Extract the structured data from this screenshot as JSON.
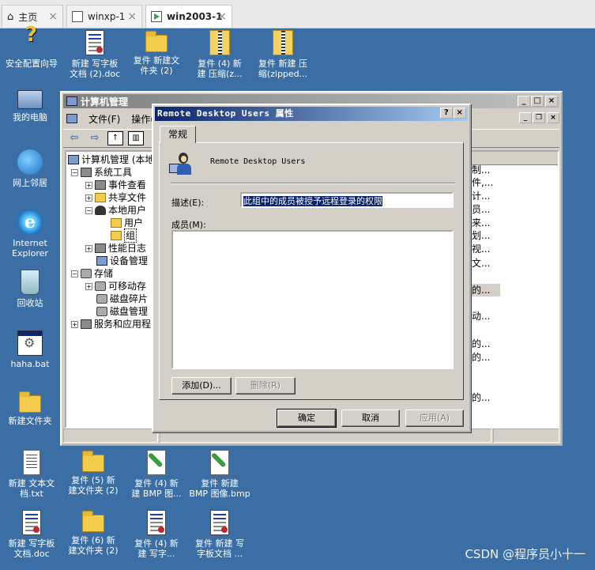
{
  "browser_tabs": [
    {
      "label": "主页",
      "icon": "home-icon"
    },
    {
      "label": "winxp-1",
      "icon": "vm-icon"
    },
    {
      "label": "win2003-1",
      "icon": "vm-icon",
      "active": true
    }
  ],
  "desktop_icons": [
    {
      "label": "安全配置向导",
      "icon": "wizard-icon"
    },
    {
      "label": "新建 写字板\n文档 (2).doc",
      "icon": "wordpad-doc-icon"
    },
    {
      "label": "复件 新建文\n件夹 (2)",
      "icon": "folder-icon"
    },
    {
      "label": "复件 (4) 新\n建 压缩(z...",
      "icon": "zip-icon"
    },
    {
      "label": "复件 新建 压\n缩(zipped...",
      "icon": "zip-icon"
    },
    {
      "label": "我的电脑",
      "icon": "my-computer-icon"
    },
    {
      "label": "网上邻居",
      "icon": "network-icon"
    },
    {
      "label": "Internet\nExplorer",
      "icon": "ie-icon"
    },
    {
      "label": "回收站",
      "icon": "recycle-bin-icon"
    },
    {
      "label": "haha.bat",
      "icon": "batch-file-icon"
    },
    {
      "label": "新建文件夹",
      "icon": "folder-icon"
    },
    {
      "label": "新建 文本文\n档.txt",
      "icon": "text-file-icon"
    },
    {
      "label": "复件 (5) 新\n建文件夹 (2)",
      "icon": "folder-icon"
    },
    {
      "label": "复件 (4) 新\n建 BMP 图...",
      "icon": "bmp-icon"
    },
    {
      "label": "复件 新建\nBMP 图像.bmp",
      "icon": "bmp-icon"
    },
    {
      "label": "新建 写字板\n文档.doc",
      "icon": "wordpad-doc-icon"
    },
    {
      "label": "复件 (6) 新\n建文件夹 (2)",
      "icon": "folder-icon"
    },
    {
      "label": "复件 (4) 新\n建 写字...",
      "icon": "wordpad-doc-icon"
    },
    {
      "label": "复件 新建 写\n字板文档 ...",
      "icon": "wordpad-doc-icon"
    }
  ],
  "cm_window": {
    "title": "计算机管理",
    "menu": [
      "文件(F)",
      "操作("
    ],
    "tree": [
      {
        "label": "计算机管理 (本地",
        "indent": 0,
        "expander": ""
      },
      {
        "label": "系统工具",
        "indent": 1,
        "expander": "−"
      },
      {
        "label": "事件查看",
        "indent": 2,
        "expander": "+"
      },
      {
        "label": "共享文件",
        "indent": 2,
        "expander": "+"
      },
      {
        "label": "本地用户",
        "indent": 2,
        "expander": "−"
      },
      {
        "label": "用户",
        "indent": 3,
        "expander": ""
      },
      {
        "label": "组",
        "indent": 3,
        "expander": ""
      },
      {
        "label": "性能日志",
        "indent": 2,
        "expander": "+"
      },
      {
        "label": "设备管理",
        "indent": 2,
        "expander": ""
      },
      {
        "label": "存储",
        "indent": 1,
        "expander": "−"
      },
      {
        "label": "可移动存",
        "indent": 2,
        "expander": "+"
      },
      {
        "label": "磁盘碎片",
        "indent": 2,
        "expander": ""
      },
      {
        "label": "磁盘管理",
        "indent": 2,
        "expander": ""
      },
      {
        "label": "服务和应用程",
        "indent": 1,
        "expander": "+"
      }
    ],
    "descriptions": [
      "制...",
      "件,...",
      "计...",
      "员...",
      "来...",
      "划...",
      "视...",
      "文...",
      "的...",
      "动...",
      "的...",
      "的...",
      "的..."
    ]
  },
  "dialog": {
    "title": "Remote Desktop Users 属性",
    "help_btn": "?",
    "close_btn": "×",
    "tab": "常规",
    "group_name": "Remote Desktop Users",
    "desc_label": "描述(E):",
    "desc_value": "此组中的成员被授予远程登录的权限",
    "members_label": "成员(M):",
    "add_btn": "添加(D)...",
    "remove_btn": "删除(R)",
    "ok_btn": "确定",
    "cancel_btn": "取消",
    "apply_btn": "应用(A)"
  },
  "watermark": "CSDN @程序员小十一"
}
